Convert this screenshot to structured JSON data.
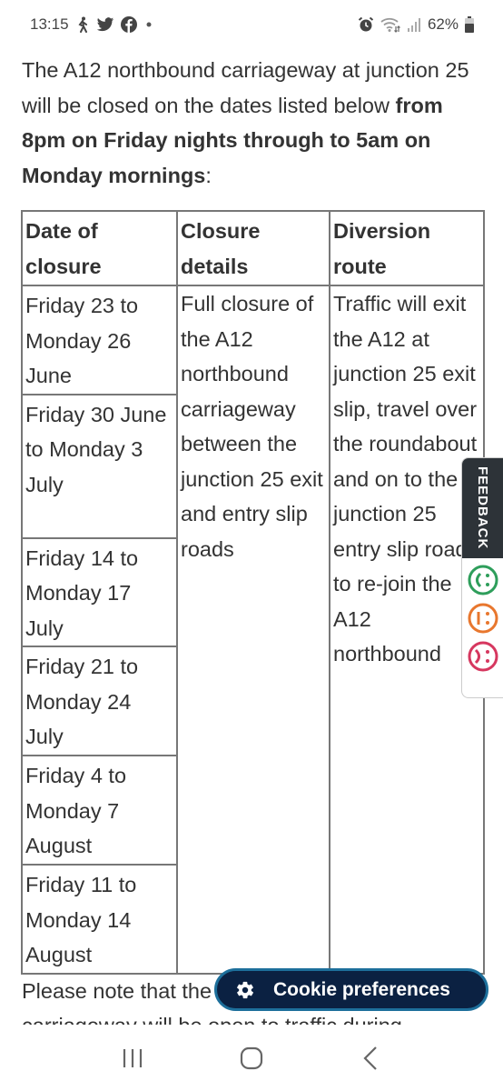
{
  "status_bar": {
    "time": "13:15",
    "left_icons": [
      "walking-icon",
      "twitter-icon",
      "facebook-icon",
      "notification-dot-icon"
    ],
    "right_icons": [
      "alarm-icon",
      "wifi-icon",
      "signal-icon",
      "battery-icon"
    ],
    "battery": "62%"
  },
  "intro": {
    "text_plain": "The A12 northbound carriageway at junction 25 will be closed on the dates listed below ",
    "text_bold": "from 8pm on Friday nights through to 5am on Monday mornings",
    "text_end": ":"
  },
  "table": {
    "headers": [
      "Date of closure",
      "Closure details",
      "Diversion route"
    ],
    "dates": [
      "Friday 23 to Monday 26 June",
      "Friday 30 June to Monday 3 July",
      "Friday 14 to Monday 17 July",
      "Friday 21 to Monday 24 July",
      "Friday 4 to Monday 7 August",
      "Friday 11 to Monday 14 August"
    ],
    "closure_details": "Full closure of the A12 northbound carriageway between the junction 25 exit and entry slip roads",
    "diversion_route": "Traffic will exit the A12 at junction 25 exit slip, travel over the roundabout and on to the junction 25 entry slip road to re-join the A12 northbound"
  },
  "note": {
    "text": "Please note that the",
    "text_line2": "carriageway will be open to traffic during"
  },
  "cookie_button": {
    "label": "Cookie preferences",
    "icon": "gear-icon",
    "bg_color": "#0b2142",
    "border_color": "#1d6f9b"
  },
  "feedback": {
    "label": "FEEDBACK",
    "faces": [
      {
        "name": "happy-face-icon",
        "color": "#2e9e5b"
      },
      {
        "name": "neutral-face-icon",
        "color": "#e8772e"
      },
      {
        "name": "sad-face-icon",
        "color": "#d6375f"
      }
    ]
  },
  "nav_bar": {
    "buttons": [
      "recent-apps-icon",
      "home-icon",
      "back-icon"
    ]
  }
}
